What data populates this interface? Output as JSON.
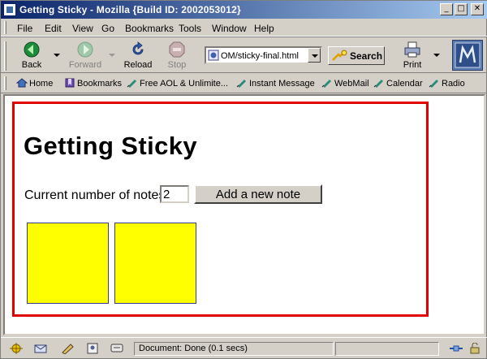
{
  "window": {
    "title": "Getting Sticky - Mozilla {Build ID: 2002053012}"
  },
  "window_controls": {
    "minimize": "_",
    "maximize": "□",
    "close": "✕"
  },
  "menu": [
    "File",
    "Edit",
    "View",
    "Go",
    "Bookmarks",
    "Tools",
    "Window",
    "Help"
  ],
  "nav": {
    "back": "Back",
    "forward": "Forward",
    "reload": "Reload",
    "stop": "Stop",
    "url": "OM/sticky-final.html",
    "search": "Search",
    "print": "Print"
  },
  "personal": {
    "home": "Home",
    "bookmarks": "Bookmarks",
    "links": [
      "Free AOL & Unlimite...",
      "Instant Message",
      "WebMail",
      "Calendar",
      "Radio"
    ]
  },
  "page": {
    "title": "Getting Sticky",
    "count_label": "Current number of notes",
    "count_value": "2",
    "add_button": "Add a new note"
  },
  "status": {
    "text": "Document: Done (0.1 secs)"
  },
  "colors": {
    "note": "#ffff00",
    "frame": "#e00000",
    "titlebar": "#0a246a"
  },
  "icons": [
    "app-icon",
    "back-icon",
    "forward-icon",
    "reload-icon",
    "stop-icon",
    "print-icon",
    "search-icon",
    "home-icon",
    "bookmarks-icon",
    "link-icon"
  ]
}
